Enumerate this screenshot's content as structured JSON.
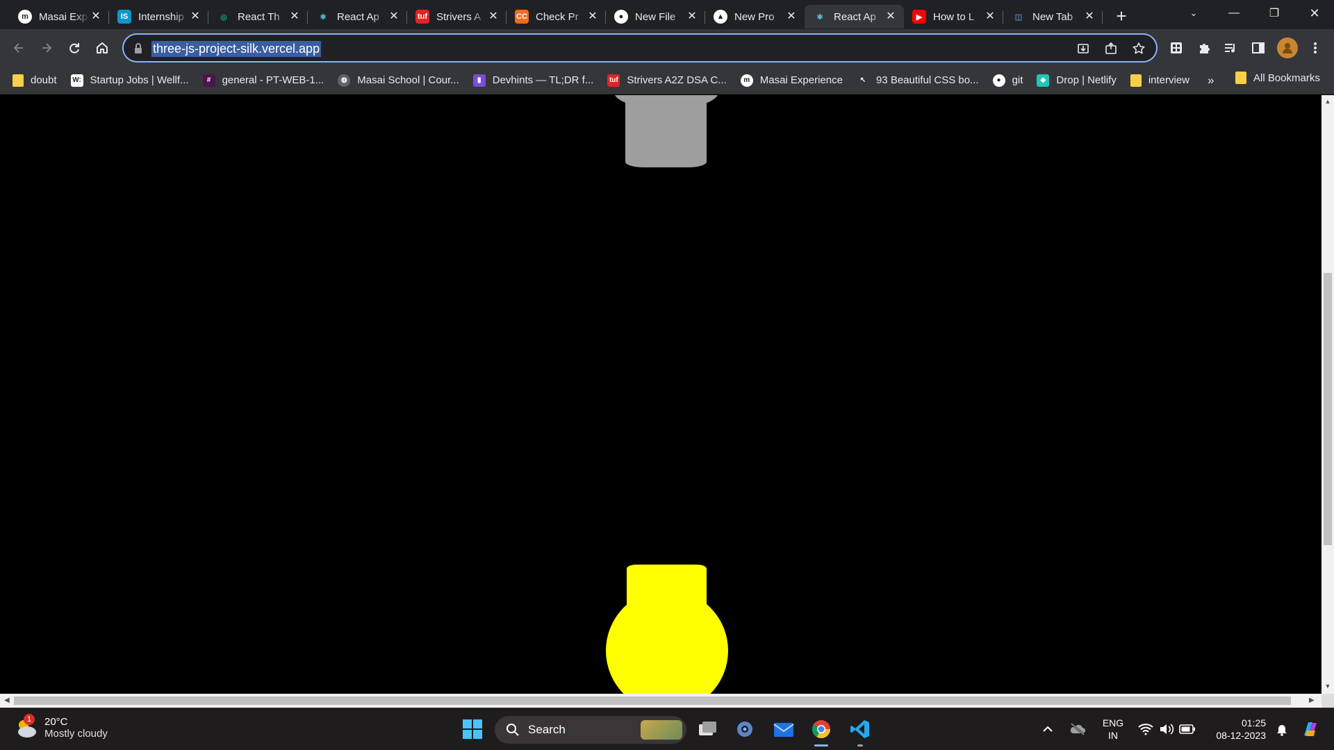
{
  "browser": {
    "tabs": [
      {
        "title": "Masai Exp",
        "favicon": "masai-icon",
        "fav_color": "#ffffff",
        "fav_text": "m"
      },
      {
        "title": "Internship",
        "favicon": "internshala-icon",
        "fav_color": "#1295c9",
        "fav_text": "IS"
      },
      {
        "title": "React Th",
        "favicon": "chatgpt-icon",
        "fav_color": "#10a37f",
        "fav_text": "◎"
      },
      {
        "title": "React Ap",
        "favicon": "react-icon",
        "fav_color": "#61dafb",
        "fav_text": "⚛"
      },
      {
        "title": "Strivers A",
        "favicon": "tuf-icon",
        "fav_color": "#e02424",
        "fav_text": "tuf"
      },
      {
        "title": "Check Pr",
        "favicon": "codechef-icon",
        "fav_color": "#f26b21",
        "fav_text": "CC"
      },
      {
        "title": "New File",
        "favicon": "github-icon",
        "fav_color": "#ffffff",
        "fav_text": "●"
      },
      {
        "title": "New Pro",
        "favicon": "vercel-icon",
        "fav_color": "#ffffff",
        "fav_text": "▲"
      },
      {
        "title": "React Ap",
        "favicon": "react-icon",
        "fav_color": "#61dafb",
        "fav_text": "⚛",
        "active": true
      },
      {
        "title": "How to L",
        "favicon": "youtube-icon",
        "fav_color": "#ff0000",
        "fav_text": "▶"
      },
      {
        "title": "New Tab",
        "favicon": "newtab-icon",
        "fav_color": "#5b7fd6",
        "fav_text": "◫"
      }
    ],
    "url": "three-js-project-silk.vercel.app",
    "bookmarks": [
      {
        "label": "doubt",
        "type": "folder"
      },
      {
        "label": "Startup Jobs | Wellf...",
        "type": "site",
        "icon": "wellfound-icon",
        "color": "#ffffff",
        "text": "W:"
      },
      {
        "label": "general - PT-WEB-1...",
        "type": "site",
        "icon": "slack-icon",
        "color": "#4a154b",
        "text": "#"
      },
      {
        "label": "Masai School | Cour...",
        "type": "site",
        "icon": "globe-icon",
        "color": "#5f6368",
        "text": "◍"
      },
      {
        "label": "Devhints — TL;DR f...",
        "type": "site",
        "icon": "devhints-icon",
        "color": "#7b4cd9",
        "text": "▮"
      },
      {
        "label": "Strivers A2Z DSA C...",
        "type": "site",
        "icon": "tuf-icon",
        "color": "#e02424",
        "text": "tuf"
      },
      {
        "label": "Masai Experience",
        "type": "site",
        "icon": "masai-icon",
        "color": "#ffffff",
        "text": "m"
      },
      {
        "label": "93 Beautiful CSS bo...",
        "type": "site",
        "icon": "getcssscan-icon",
        "color": "#35363a",
        "text": "↖"
      },
      {
        "label": "git",
        "type": "site",
        "icon": "github-icon",
        "color": "#ffffff",
        "text": "●"
      },
      {
        "label": "Drop | Netlify",
        "type": "site",
        "icon": "netlify-icon",
        "color": "#20c6b7",
        "text": "◆"
      },
      {
        "label": "interview",
        "type": "folder"
      }
    ],
    "bookmarks_more": "»",
    "all_bookmarks": "All Bookmarks"
  },
  "taskbar": {
    "weather_temp": "20°C",
    "weather_condition": "Mostly cloudy",
    "weather_badge": "1",
    "search_label": "Search",
    "language_line1": "ENG",
    "language_line2": "IN",
    "time": "01:25",
    "date": "08-12-2023"
  },
  "colors": {
    "top_object": "#9e9e9e",
    "bottom_object": "#ffff00",
    "page_background": "#000000"
  }
}
